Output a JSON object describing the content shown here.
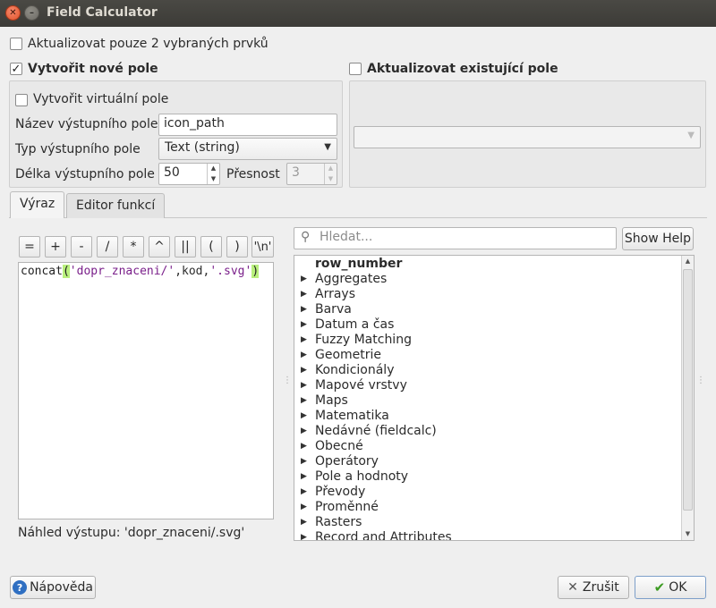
{
  "window": {
    "title": "Field Calculator"
  },
  "update_selected": {
    "label": "Aktualizovat pouze 2 vybraných prvků",
    "checked": false
  },
  "create_new": {
    "label": "Vytvořit nové pole",
    "checked": true,
    "virtual_label": "Vytvořit virtuální pole",
    "virtual_checked": false,
    "name_label": "Název výstupního pole",
    "name_value": "icon_path",
    "type_label": "Typ výstupního pole",
    "type_value": "Text (string)",
    "length_label": "Délka výstupního pole",
    "length_value": "50",
    "precision_label": "Přesnost",
    "precision_value": "3"
  },
  "update_existing": {
    "label": "Aktualizovat existující pole",
    "checked": false,
    "field_value": ""
  },
  "tabs": [
    {
      "label": "Výraz",
      "active": true
    },
    {
      "label": "Editor funkcí",
      "active": false
    }
  ],
  "operators": [
    "=",
    "+",
    "-",
    "/",
    "*",
    "^",
    "||",
    "(",
    ")",
    "'\\n'"
  ],
  "expression": {
    "fn": "concat",
    "open": "(",
    "arg1": "'dopr_znaceni/'",
    "sep1": ",kod,",
    "arg2": "'.svg'",
    "close": ")"
  },
  "preview": "Náhled výstupu: 'dopr_znaceni/.svg'",
  "search": {
    "placeholder": "Hledat...",
    "value": ""
  },
  "show_help_label": "Show Help",
  "function_tree": [
    {
      "label": "row_number",
      "bold": true,
      "expandable": false
    },
    {
      "label": "Aggregates",
      "expandable": true
    },
    {
      "label": "Arrays",
      "expandable": true
    },
    {
      "label": "Barva",
      "expandable": true
    },
    {
      "label": "Datum a čas",
      "expandable": true
    },
    {
      "label": "Fuzzy Matching",
      "expandable": true
    },
    {
      "label": "Geometrie",
      "expandable": true
    },
    {
      "label": "Kondicionály",
      "expandable": true
    },
    {
      "label": "Mapové vrstvy",
      "expandable": true
    },
    {
      "label": "Maps",
      "expandable": true
    },
    {
      "label": "Matematika",
      "expandable": true
    },
    {
      "label": "Nedávné (fieldcalc)",
      "expandable": true
    },
    {
      "label": "Obecné",
      "expandable": true
    },
    {
      "label": "Operátory",
      "expandable": true
    },
    {
      "label": "Pole a hodnoty",
      "expandable": true
    },
    {
      "label": "Převody",
      "expandable": true
    },
    {
      "label": "Proměnné",
      "expandable": true
    },
    {
      "label": "Rasters",
      "expandable": true
    },
    {
      "label": "Record and Attributes",
      "expandable": true
    }
  ],
  "buttons": {
    "help": "Nápověda",
    "cancel": "Zrušit",
    "ok": "OK"
  },
  "icons": {
    "close": "close-icon",
    "minimize": "minimize-icon",
    "search": "search-icon",
    "help": "help-icon",
    "cancel": "cancel-icon",
    "ok": "checkmark-icon"
  }
}
